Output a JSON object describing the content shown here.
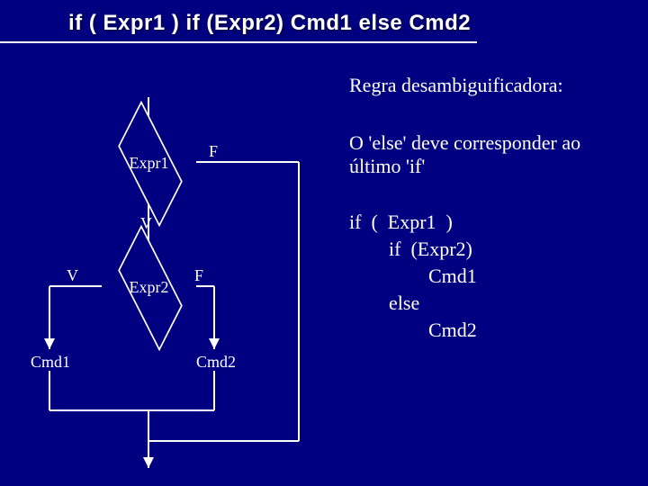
{
  "title": "if  (  Expr1  )  if  (Expr2)  Cmd1  else  Cmd2",
  "right": {
    "heading": "Regra desambiguificadora:",
    "desc": "O 'else' deve corresponder ao último 'if'",
    "code": "if  (  Expr1  )\n        if  (Expr2)\n                Cmd1\n        else\n                Cmd2"
  },
  "flow": {
    "expr1": "Expr1",
    "expr2": "Expr2",
    "v1": "V",
    "v2": "V",
    "f1": "F",
    "f2": "F",
    "cmd1": "Cmd1",
    "cmd2": "Cmd2"
  }
}
